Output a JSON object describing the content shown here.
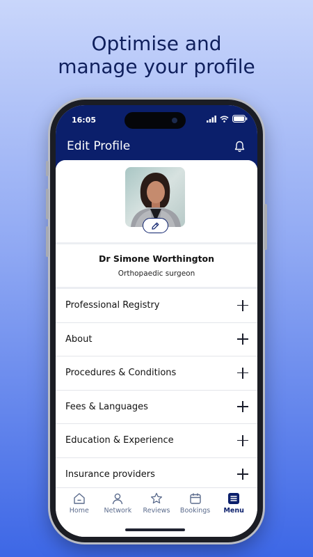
{
  "headline": {
    "line1": "Optimise and",
    "line2": "manage your profile"
  },
  "status": {
    "time": "16:05"
  },
  "appbar": {
    "title": "Edit Profile",
    "icon": "bell-icon"
  },
  "profile": {
    "name": "Dr Simone Worthington",
    "role": "Orthopaedic surgeon",
    "edit_icon": "pencil-icon"
  },
  "sections": [
    {
      "label": "Professional Registry"
    },
    {
      "label": "About"
    },
    {
      "label": "Procedures & Conditions"
    },
    {
      "label": "Fees & Languages"
    },
    {
      "label": "Education & Experience"
    },
    {
      "label": "Insurance providers"
    }
  ],
  "tabs": [
    {
      "label": "Home",
      "icon": "home-icon"
    },
    {
      "label": "Network",
      "icon": "person-icon"
    },
    {
      "label": "Reviews",
      "icon": "star-icon"
    },
    {
      "label": "Bookings",
      "icon": "calendar-icon"
    },
    {
      "label": "Menu",
      "icon": "menu-icon",
      "active": true
    }
  ],
  "colors": {
    "brand": "#0b1f6b",
    "background_top": "#c9d6fb",
    "background_bottom": "#3d67e6"
  }
}
